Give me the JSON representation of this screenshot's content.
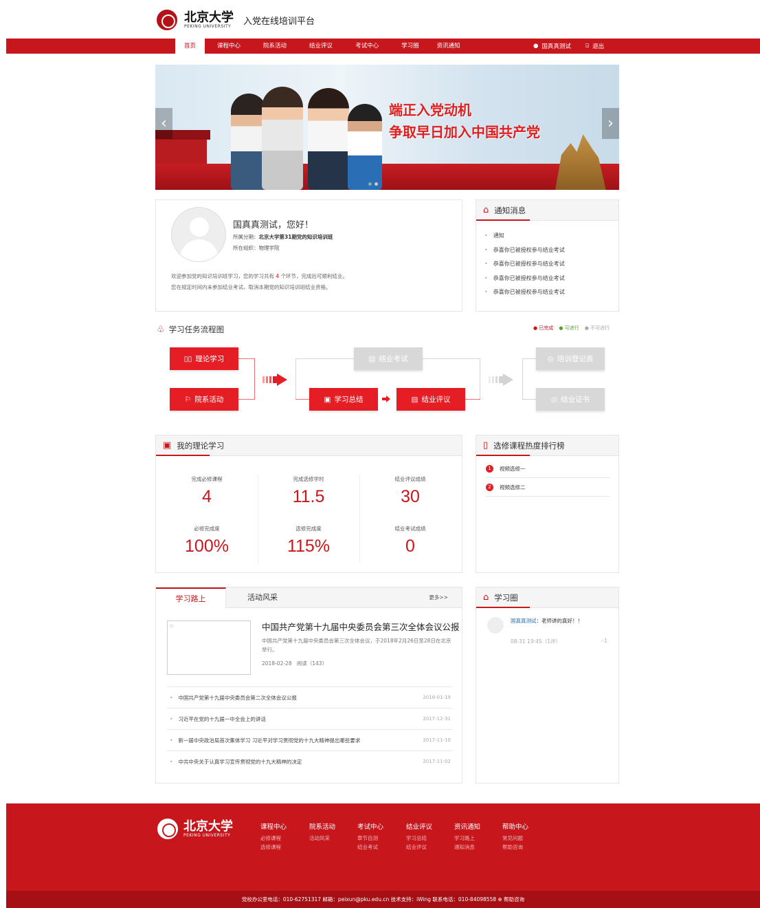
{
  "header": {
    "logo_cn": "北京大学",
    "logo_en": "PEKING UNIVERSITY",
    "site_title": "入党在线培训平台"
  },
  "nav": {
    "items": [
      "首页",
      "课程中心",
      "院系活动",
      "结业评议",
      "考试中心",
      "学习圈",
      "资讯通知"
    ],
    "user": "国真真测试",
    "logout": "退出"
  },
  "banner": {
    "slogan_line1": "端正入党动机",
    "slogan_line2": "争取早日加入中国共产党",
    "prev": "‹",
    "next": "›"
  },
  "profile": {
    "greeting": "国真真测试，您好！",
    "period_label": "所属分期：",
    "period_value": "北京大学第31期党的知识培训班",
    "org_label": "所在组织：",
    "org_value": "物理学院",
    "intro_line1_a": "欢迎参加党的知识培训班学习，您的学习共有",
    "intro_line1_num": "4",
    "intro_line1_b": "个环节，完成后可顺利结业。",
    "intro_line2": "您在规定时间内未参加结业考试，取消本期党的知识培训班结业资格。"
  },
  "notice": {
    "title": "通知消息",
    "items": [
      "通知",
      "恭喜你已被授权参与结业考试",
      "恭喜你已被授权参与结业考试",
      "恭喜你已被授权参与结业考试",
      "恭喜你已被授权参与结业考试"
    ]
  },
  "flow": {
    "title": "学习任务流程图",
    "legend": {
      "done": "● 已完成",
      "ing": "● 可进行",
      "no": "● 不可进行"
    },
    "steps": {
      "theory": "理论学习",
      "activity": "院系活动",
      "exam": "结业考试",
      "summary": "学习总结",
      "review": "结业评议",
      "record": "培训登记表",
      "cert": "结业证书"
    }
  },
  "study": {
    "title": "我的理论学习",
    "stats": [
      {
        "label": "完成必修课程",
        "value": "4"
      },
      {
        "label": "完成选修学时",
        "value": "11.5"
      },
      {
        "label": "结业评议成绩",
        "value": "30"
      },
      {
        "label": "必修完成度",
        "value": "100%"
      },
      {
        "label": "选修完成度",
        "value": "115%"
      },
      {
        "label": "结业考试成绩",
        "value": "0"
      }
    ]
  },
  "rank": {
    "title": "选修课程热度排行榜",
    "items": [
      {
        "n": "1",
        "name": "视频选修一"
      },
      {
        "n": "2",
        "name": "视频选修二"
      }
    ]
  },
  "news": {
    "tabs": [
      "学习路上",
      "活动风采"
    ],
    "more": "更多>>",
    "featured": {
      "title": "中国共产党第十九届中央委员会第三次全体会议公报",
      "desc": "中国共产党第十九届中央委员会第三次全体会议，于2018年2月26日至28日在北京举行。",
      "date": "2018-02-28",
      "reads": "阅读（143）"
    },
    "list": [
      {
        "title": "中国共产党第十九届中央委员会第二次全体会议公报",
        "date": "2018-01-19"
      },
      {
        "title": "习近平在党的十九届一中全会上的讲话",
        "date": "2017-12-31"
      },
      {
        "title": "新一届中央政治局首次集体学习 习近平对学习贯彻党的十九大精神提出哪些要求",
        "date": "2017-11-10"
      },
      {
        "title": "中共中央关于认真学习宣传贯彻党的十九大精神的决定",
        "date": "2017-11-02"
      }
    ]
  },
  "circle": {
    "title": "学习圈",
    "post_user": "国真真测试",
    "post_text": "：老师讲的真好！！",
    "post_meta": "08-31 19:45（1评）",
    "post_likes": "1"
  },
  "footer": {
    "cols": [
      {
        "h": "课程中心",
        "l1": "必修课程",
        "l2": "选修课程"
      },
      {
        "h": "院系活动",
        "l1": "活动风采",
        "l2": ""
      },
      {
        "h": "考试中心",
        "l1": "章节自测",
        "l2": "结业考试"
      },
      {
        "h": "结业评议",
        "l1": "学习总结",
        "l2": "结业评议"
      },
      {
        "h": "资讯通知",
        "l1": "学习路上",
        "l2": "通知消息"
      },
      {
        "h": "帮助中心",
        "l1": "常见问题",
        "l2": "帮助咨询"
      }
    ],
    "bottom": "党校办公室电话：010-62751317   邮箱：peixun@pku.edu.cn   技术支持：iWing   联系电话：010-84098558   ⊕ 帮助咨询"
  }
}
